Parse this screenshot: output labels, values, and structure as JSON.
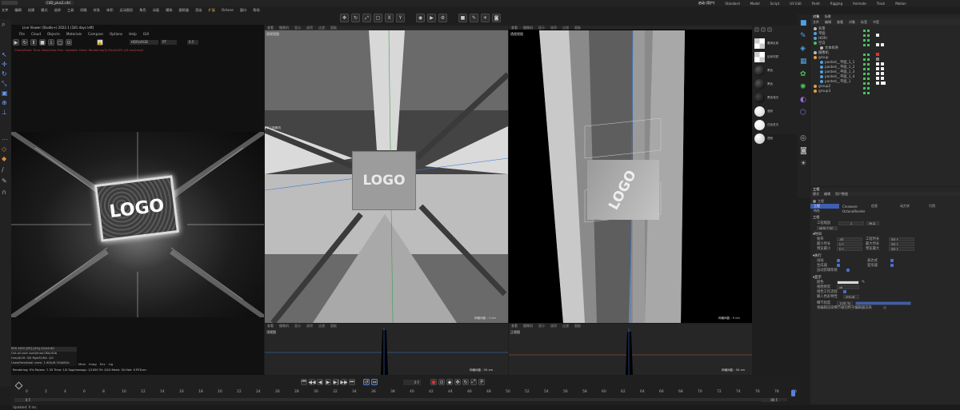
{
  "window": {
    "doc_tab": "C4D_plus2.c4d",
    "layouts": [
      "启动 (用户)",
      "Standard",
      "Model",
      "Script",
      "UV Edit",
      "Paint",
      "Rigging",
      "Animate",
      "Track",
      "Motion"
    ]
  },
  "menubar": [
    "文件",
    "编辑",
    "创建",
    "模式",
    "选择",
    "工具",
    "网格",
    "样条",
    "体积",
    "运动图形",
    "角色",
    "动画",
    "模拟",
    "跟踪器",
    "渲染",
    "扩展",
    "Octane",
    "窗口",
    "帮助"
  ],
  "live_viewer": {
    "title": "Live Viewer (Studio+) 2022.1 (181 days left)",
    "menu": [
      "File",
      "Cloud",
      "Objects",
      "Materials",
      "Compare",
      "Options",
      "Help",
      "GUI"
    ],
    "mode": "HDR/sRGB",
    "color_mode": "PT",
    "value": "0.5",
    "status_line": "Check/Feed: Time: Mesh/Geo Prec: Updated: Done: Rendering(5) Mesh/GPU 4.8 ms/2ms/0",
    "logo_text": "LOGO",
    "info_rows": [
      "RTX 3070 [RT] [0%]   0/140   8C",
      "Out-of-core used/max:0Kb/4Gb",
      "Grey8/16: 0/0         Rgb32/64: 1/0",
      "Used/free/total vram: 1.6Gb/6.3Gb/8Gb"
    ],
    "tabs": [
      "Main",
      "Imag",
      "Env",
      "Lig"
    ],
    "render_status": "Rendering: 0%   Ms/sec: 7.35   Time: 1/0  Spp/maxspp: 1/1000   Tri: 0/10    Mesh: 34   Hair: 0   RTX:on"
  },
  "viewport_menu": [
    "查看",
    "摄像机",
    "显示",
    "选项",
    "过滤",
    "面板"
  ],
  "viewport_left": {
    "label": "透视视图",
    "camera": "默认摄像机",
    "logo_text": "LOGO",
    "grid_size": "网格间距 : 1 cm"
  },
  "viewport_right": {
    "label": "透视视图",
    "logo_text": "LOGO",
    "grid_size": "网格间距 : 5 cm"
  },
  "bottom_views": [
    {
      "label": "顶视图",
      "grid": "网格间距 : 50 cm"
    },
    {
      "label": "正视图",
      "grid": "网格间距 : 50 cm"
    }
  ],
  "timeline": {
    "ticks": [
      "0",
      "2",
      "4",
      "6",
      "8",
      "10",
      "12",
      "14",
      "16",
      "18",
      "20",
      "22",
      "24",
      "26",
      "28",
      "30",
      "32",
      "34",
      "36",
      "38",
      "40",
      "42",
      "44",
      "46",
      "48",
      "50",
      "52",
      "54",
      "56",
      "58",
      "60",
      "62",
      "64",
      "66",
      "68",
      "70",
      "72",
      "74",
      "76",
      "78",
      "80"
    ],
    "current": "0 F",
    "start": "0 F",
    "end": "80 F",
    "end2": "80 F",
    "fps": "80 F"
  },
  "statusbar": "Updated: 0 ms",
  "objects": {
    "tabs": [
      "对象",
      "场景"
    ],
    "menu": [
      "文件",
      "编辑",
      "查看",
      "对象",
      "标签",
      "书签"
    ],
    "items": [
      {
        "name": "背景",
        "depth": 0
      },
      {
        "name": "平面",
        "depth": 0
      },
      {
        "name": "HDRI",
        "depth": 0
      },
      {
        "name": "空白",
        "depth": 0
      },
      {
        "name": "文本样条",
        "depth": 1
      },
      {
        "name": "摄像机",
        "depth": 0
      },
      {
        "name": "group",
        "depth": 0
      },
      {
        "name": "pasted__平面_1_1",
        "depth": 1
      },
      {
        "name": "pasted__平面_1_2",
        "depth": 1
      },
      {
        "name": "pasted__平面_1_3",
        "depth": 1
      },
      {
        "name": "pasted__平面_1_4",
        "depth": 1
      },
      {
        "name": "pasted__平面_1",
        "depth": 1
      },
      {
        "name": "group2",
        "depth": 0
      },
      {
        "name": "group3",
        "depth": 0
      }
    ]
  },
  "materials": [
    "置换反射",
    "反射材质",
    "黑色",
    "黑色",
    "黑色哑光",
    "漫射",
    "白色发光",
    "透射",
    "文字发光"
  ],
  "attributes": {
    "tabs": [
      "模式",
      "编辑",
      "用户数据"
    ],
    "section_title": "工程",
    "tab_row1": [
      "工程",
      "Cineware",
      "信息",
      "动力学",
      "引用"
    ],
    "tab_row2": [
      "待办",
      "OctaneRender"
    ],
    "heading": "工程",
    "scale_label": "工程缩放",
    "scale_value": "1",
    "scale_unit": "厘米",
    "scale_btn": "缩放工程...",
    "time_header": "时间",
    "fps_label": "帧率",
    "fps_value": "30",
    "proj_time_label": "工程时长",
    "proj_time_value": "80 F",
    "min_label": "最小时长",
    "min_value": "0 F",
    "max_label": "最大时长",
    "max_value": "80 F",
    "prev_min_label": "预览最小",
    "prev_min_value": "0 F",
    "prev_max_label": "预览最大",
    "prev_max_value": "80 F",
    "exec_header": "执行",
    "anim_label": "动画",
    "expr_label": "表达式",
    "gen_label": "生成器",
    "deform_label": "变形器",
    "motion_label": "运动剪辑系统",
    "display_header": "显示",
    "color_label": "颜色",
    "view_clip_label": "视图修剪",
    "view_clip_value": "中",
    "linear_label": "线性工作流程",
    "input_color_label": "输入色彩特性",
    "input_color_value": "sRGB",
    "lod_label": "细节程度",
    "lod_value": "100 %",
    "lod_note": "将编辑渲染细节级别用于编辑器渲染"
  }
}
